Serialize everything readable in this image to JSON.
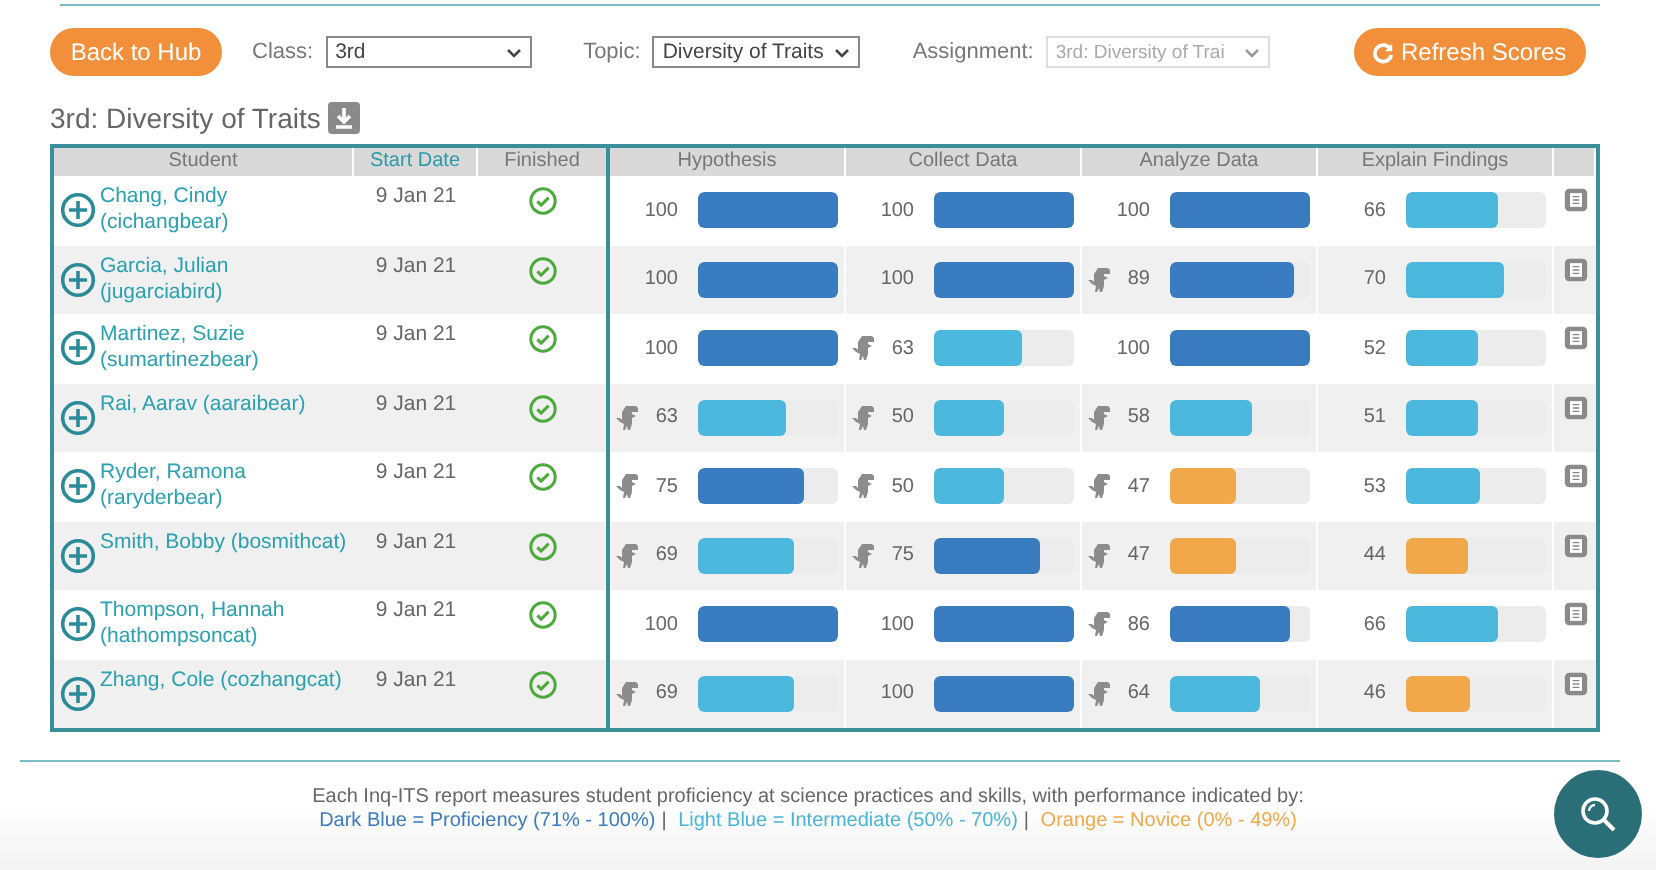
{
  "toolbar": {
    "back_button": "Back to Hub",
    "class_label": "Class:",
    "class_value": "3rd",
    "topic_label": "Topic:",
    "topic_value": "Diversity of Traits",
    "assignment_label": "Assignment:",
    "assignment_value": "3rd: Diversity of Trai",
    "assignment_disabled": true,
    "refresh_button": "Refresh Scores"
  },
  "report_title": "3rd: Diversity of Traits",
  "table": {
    "columns": [
      "Student",
      "Start Date",
      "Finished",
      "Hypothesis",
      "Collect Data",
      "Analyze Data",
      "Explain Findings"
    ],
    "rows": [
      {
        "student": "Chang, Cindy (cichangbear)",
        "start_date": "9 Jan 21",
        "finished": true,
        "scores": [
          {
            "score": "100",
            "level": 1,
            "tutor": false
          },
          {
            "score": "100",
            "level": 1,
            "tutor": false
          },
          {
            "score": "100",
            "level": 1,
            "tutor": false
          },
          {
            "score": "66",
            "level": 0.66,
            "tutor": false
          }
        ]
      },
      {
        "student": "Garcia, Julian (jugarciabird)",
        "start_date": "9 Jan 21",
        "finished": true,
        "scores": [
          {
            "score": "100",
            "level": 1,
            "tutor": false
          },
          {
            "score": "100",
            "level": 1,
            "tutor": false
          },
          {
            "score": "89",
            "level": 0.89,
            "tutor": true
          },
          {
            "score": "70",
            "level": 0.7,
            "tutor": false
          }
        ]
      },
      {
        "student": "Martinez, Suzie (sumartinezbear)",
        "start_date": "9 Jan 21",
        "finished": true,
        "scores": [
          {
            "score": "100",
            "level": 1,
            "tutor": false
          },
          {
            "score": "63",
            "level": 0.63,
            "tutor": true
          },
          {
            "score": "100",
            "level": 1,
            "tutor": false
          },
          {
            "score": "52",
            "level": 0.52,
            "tutor": false
          }
        ]
      },
      {
        "student": "Rai, Aarav (aaraibear)",
        "start_date": "9 Jan 21",
        "finished": true,
        "scores": [
          {
            "score": "63",
            "level": 0.63,
            "tutor": true
          },
          {
            "score": "50",
            "level": 0.5,
            "tutor": true
          },
          {
            "score": "58",
            "level": 0.58,
            "tutor": true
          },
          {
            "score": "51",
            "level": 0.51,
            "tutor": false
          }
        ]
      },
      {
        "student": "Ryder, Ramona (raryderbear)",
        "start_date": "9 Jan 21",
        "finished": true,
        "scores": [
          {
            "score": "75",
            "level": 0.75,
            "tutor": true
          },
          {
            "score": "50",
            "level": 0.5,
            "tutor": true
          },
          {
            "score": "47",
            "level": 0.47,
            "tutor": true
          },
          {
            "score": "53",
            "level": 0.53,
            "tutor": false
          }
        ]
      },
      {
        "student": "Smith, Bobby (bosmithcat)",
        "start_date": "9 Jan 21",
        "finished": true,
        "scores": [
          {
            "score": "69",
            "level": 0.69,
            "tutor": true
          },
          {
            "score": "75",
            "level": 0.75,
            "tutor": true
          },
          {
            "score": "47",
            "level": 0.47,
            "tutor": true
          },
          {
            "score": "44",
            "level": 0.44,
            "tutor": false
          }
        ]
      },
      {
        "student": "Thompson, Hannah (hathompsoncat)",
        "start_date": "9 Jan 21",
        "finished": true,
        "scores": [
          {
            "score": "100",
            "level": 1,
            "tutor": false
          },
          {
            "score": "100",
            "level": 1,
            "tutor": false
          },
          {
            "score": "86",
            "level": 0.86,
            "tutor": true
          },
          {
            "score": "66",
            "level": 0.66,
            "tutor": false
          }
        ]
      },
      {
        "student": "Zhang, Cole (cozhangcat)",
        "start_date": "9 Jan 21",
        "finished": true,
        "scores": [
          {
            "score": "69",
            "level": 0.69,
            "tutor": true
          },
          {
            "score": "100",
            "level": 1,
            "tutor": false
          },
          {
            "score": "64",
            "level": 0.64,
            "tutor": true
          },
          {
            "score": "46",
            "level": 0.46,
            "tutor": false
          }
        ]
      }
    ]
  },
  "legend": {
    "text": "Each Inq-ITS report measures student proficiency at science practices and skills, with performance indicated by:",
    "items": [
      {
        "label": "Dark Blue = Proficiency (71% - 100%)",
        "color": "#3b7bbf"
      },
      {
        "label": "Light Blue = Intermediate (50% - 70%)",
        "color": "#4ab4d8"
      },
      {
        "label": "Orange = Novice (0% - 49%)",
        "color": "#f0a84a"
      }
    ],
    "separator": "|"
  }
}
